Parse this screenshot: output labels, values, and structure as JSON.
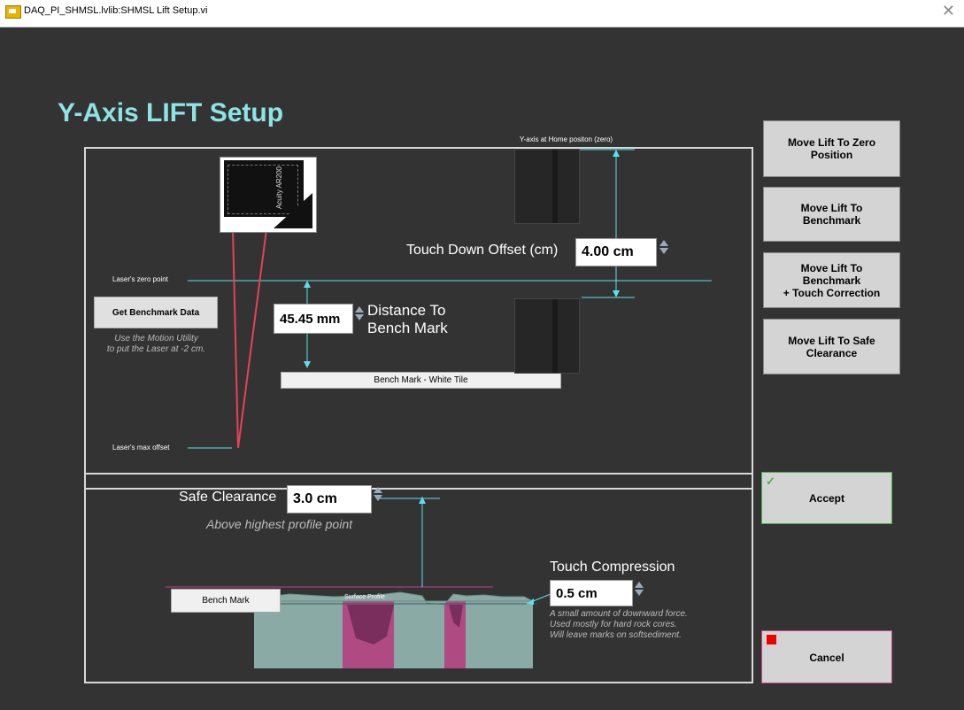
{
  "window": {
    "title": "DAQ_PI_SHMSL.lvlib:SHMSL Lift Setup.vi",
    "close_glyph": "✕"
  },
  "page_title": "Y-Axis LIFT Setup",
  "side_buttons": {
    "zero": "Move Lift To Zero\nPosition",
    "benchmark": "Move Lift To\nBenchmark",
    "touch": "Move Lift To\nBenchmark\n+ Touch Correction",
    "safe": "Move Lift To Safe\nClearance"
  },
  "upper": {
    "home_label": "Y-axis at Home positon (zero)",
    "touch_down_label": "Touch Down Offset (cm)",
    "touch_down_value": "4.00 cm",
    "laser_zero_label": "Laser's zero point",
    "laser_max_label": "Laser's max offset",
    "get_benchmark_button": "Get Benchmark Data",
    "motion_note": "Use the Motion Utility\nto put the Laser at -2 cm.",
    "distance_value": "45.45 mm",
    "distance_label": "Distance To\nBench Mark",
    "bench_tile_label": "Bench Mark  - White Tile",
    "sensor_brand": "Acuity AR200"
  },
  "lower": {
    "safe_clearance_label": "Safe Clearance",
    "safe_clearance_value": "3.0 cm",
    "safe_clearance_note": "Above highest profile point",
    "touch_compression_label": "Touch Compression",
    "touch_compression_value": "0.5 cm",
    "touch_compression_note": "A small amount of downward force.\nUsed mostly for hard rock cores.\nWill leave marks on softsediment.",
    "bench_mark_label": "Bench Mark",
    "surface_profile_label": "Surface Profile"
  },
  "accept_button": "Accept",
  "cancel_button": "Cancel",
  "colors": {
    "accent": "#8ee4e4",
    "cyan_line": "#5ee0ec",
    "laser": "#e8405a",
    "core": "#8aaaa6",
    "pink": "#b04a82"
  }
}
